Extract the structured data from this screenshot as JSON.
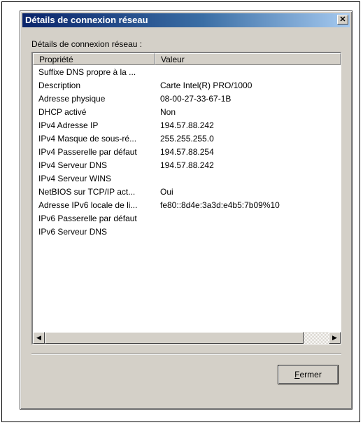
{
  "window": {
    "title": "Détails de connexion réseau",
    "close_glyph": "✕"
  },
  "group_label": "Détails de connexion réseau :",
  "list": {
    "columns": [
      "Propriété",
      "Valeur"
    ],
    "rows": [
      [
        "Suffixe DNS propre à la ...",
        ""
      ],
      [
        "Description",
        "Carte Intel(R) PRO/1000"
      ],
      [
        "Adresse physique",
        "08-00-27-33-67-1B"
      ],
      [
        "DHCP activé",
        "Non"
      ],
      [
        "IPv4 Adresse IP",
        "194.57.88.242"
      ],
      [
        "IPv4 Masque de sous-ré...",
        "255.255.255.0"
      ],
      [
        "IPv4 Passerelle par défaut",
        "194.57.88.254"
      ],
      [
        "IPv4 Serveur DNS",
        "194.57.88.242"
      ],
      [
        "IPv4 Serveur WINS",
        ""
      ],
      [
        "NetBIOS sur TCP/IP act...",
        "Oui"
      ],
      [
        "Adresse IPv6 locale de li...",
        "fe80::8d4e:3a3d:e4b5:7b09%10"
      ],
      [
        "IPv6 Passerelle par défaut",
        ""
      ],
      [
        "IPv6 Serveur DNS",
        ""
      ]
    ]
  },
  "scrollbar": {
    "left_arrow_icon": "◀",
    "right_arrow_icon": "▶"
  },
  "buttons": {
    "close_first": "F",
    "close_rest": "ermer"
  }
}
